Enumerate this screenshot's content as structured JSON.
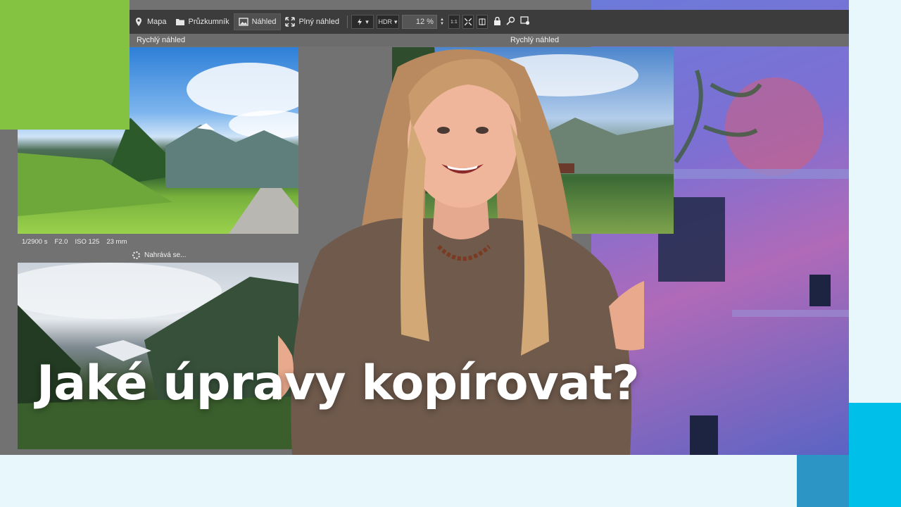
{
  "toolbar": {
    "map_label": "Mapa",
    "explorer_label": "Průzkumník",
    "preview_label": "Náhled",
    "full_preview_label": "Plný náhled",
    "hdr_label": "HDR",
    "zoom_value": "12 %",
    "one_to_one_label": "1:1"
  },
  "panels": {
    "left_title": "Rychlý náhled",
    "right_title": "Rychlý náhled"
  },
  "exif": {
    "shutter": "1/2900 s",
    "aperture": "F2.0",
    "iso": "ISO 125",
    "focal": "23 mm"
  },
  "loading_text": "Nahrává se...",
  "headline": "Jaké úpravy kopírovat?",
  "colors": {
    "green_accent": "#83c341",
    "cyan_accent": "#00bfe9",
    "blue_accent": "#2c95c6",
    "background": "#e8f7fc"
  }
}
